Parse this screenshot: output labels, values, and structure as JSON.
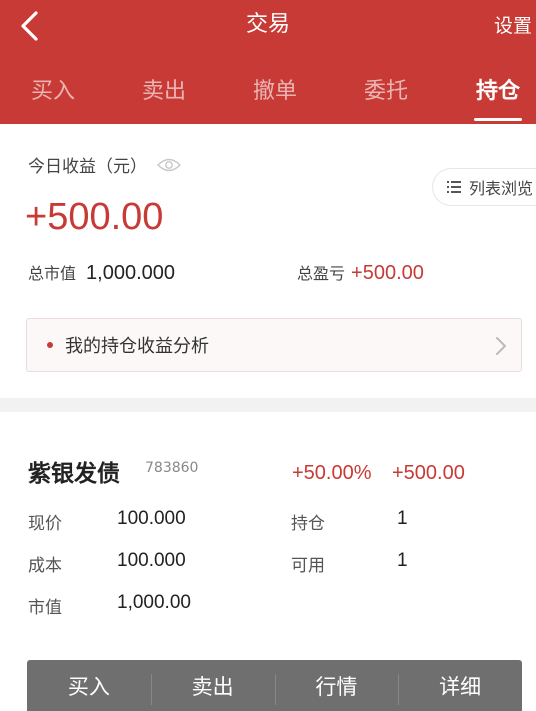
{
  "header": {
    "title": "交易",
    "settings_label": "设置",
    "back_icon": "chevron-left-icon",
    "background_color": "#c83a35"
  },
  "tabs": [
    {
      "label": "买入",
      "active": false
    },
    {
      "label": "卖出",
      "active": false
    },
    {
      "label": "撤单",
      "active": false
    },
    {
      "label": "委托",
      "active": false
    },
    {
      "label": "持仓",
      "active": true
    }
  ],
  "summary": {
    "today_label": "今日收益（元）",
    "today_value": "+500.00",
    "list_view_label": "列表浏览",
    "market_value_label": "总市值",
    "market_value": "1,000.000",
    "total_pl_label": "总盈亏",
    "total_pl": "+500.00",
    "analysis_label": "我的持仓收益分析"
  },
  "position": {
    "name": "紫银发债",
    "code": "783860",
    "pl_percent": "+50.00%",
    "pl_amount": "+500.00",
    "current_price_label": "现价",
    "current_price": "100.000",
    "cost_label": "成本",
    "cost": "100.000",
    "value_label": "市值",
    "value": "1,000.00",
    "holding_label": "持仓",
    "holding": "1",
    "available_label": "可用",
    "available": "1"
  },
  "actions": [
    {
      "label": "买入"
    },
    {
      "label": "卖出"
    },
    {
      "label": "行情"
    },
    {
      "label": "详细"
    }
  ],
  "colors": {
    "accent": "#c83a35",
    "action_bar": "#6f6f6f"
  }
}
